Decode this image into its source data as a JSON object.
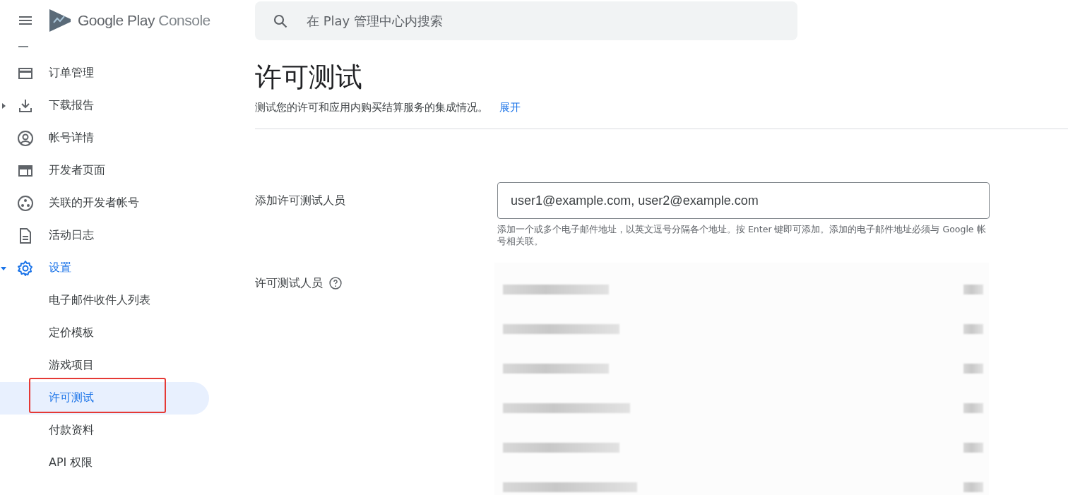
{
  "header": {
    "brand_main": "Google Play",
    "brand_sub": "Console",
    "search": {
      "placeholder": "在 Play 管理中心内搜索"
    }
  },
  "sidebar": {
    "items": [
      {
        "label": "订单管理",
        "kind": "card",
        "expandable": false,
        "expanded": false,
        "selected": false
      },
      {
        "label": "下载报告",
        "kind": "download",
        "expandable": true,
        "expanded": false,
        "selected": false
      },
      {
        "label": "帐号详情",
        "kind": "account",
        "expandable": false,
        "expanded": false,
        "selected": false
      },
      {
        "label": "开发者页面",
        "kind": "page",
        "expandable": false,
        "expanded": false,
        "selected": false
      },
      {
        "label": "关联的开发者帐号",
        "kind": "linked",
        "expandable": false,
        "expanded": false,
        "selected": false
      },
      {
        "label": "活动日志",
        "kind": "doc",
        "expandable": false,
        "expanded": false,
        "selected": false
      },
      {
        "label": "设置",
        "kind": "gear",
        "expandable": true,
        "expanded": true,
        "selected": false,
        "children": [
          {
            "label": "电子邮件收件人列表",
            "selected": false
          },
          {
            "label": "定价模板",
            "selected": false
          },
          {
            "label": "游戏项目",
            "selected": false
          },
          {
            "label": "许可测试",
            "selected": true,
            "highlighted": true
          },
          {
            "label": "付款资料",
            "selected": false
          },
          {
            "label": "API 权限",
            "selected": false
          }
        ]
      }
    ]
  },
  "page": {
    "title": "许可测试",
    "subtitle": "测试您的许可和应用内购买结算服务的集成情况。",
    "expand_link": "展开",
    "add_testers": {
      "label": "添加许可测试人员",
      "value": "user1@example.com, user2@example.com",
      "helper": "添加一个或多个电子邮件地址，以英文逗号分隔各个地址。按 Enter 键即可添加。添加的电子邮件地址必须与 Google 帐号相关联。"
    },
    "testers": {
      "label": "许可测试人员",
      "help": true,
      "rows": [
        {
          "kind": "redacted"
        },
        {
          "kind": "redacted"
        },
        {
          "kind": "redacted"
        },
        {
          "kind": "redacted"
        },
        {
          "kind": "redacted"
        },
        {
          "kind": "redacted"
        }
      ]
    }
  }
}
